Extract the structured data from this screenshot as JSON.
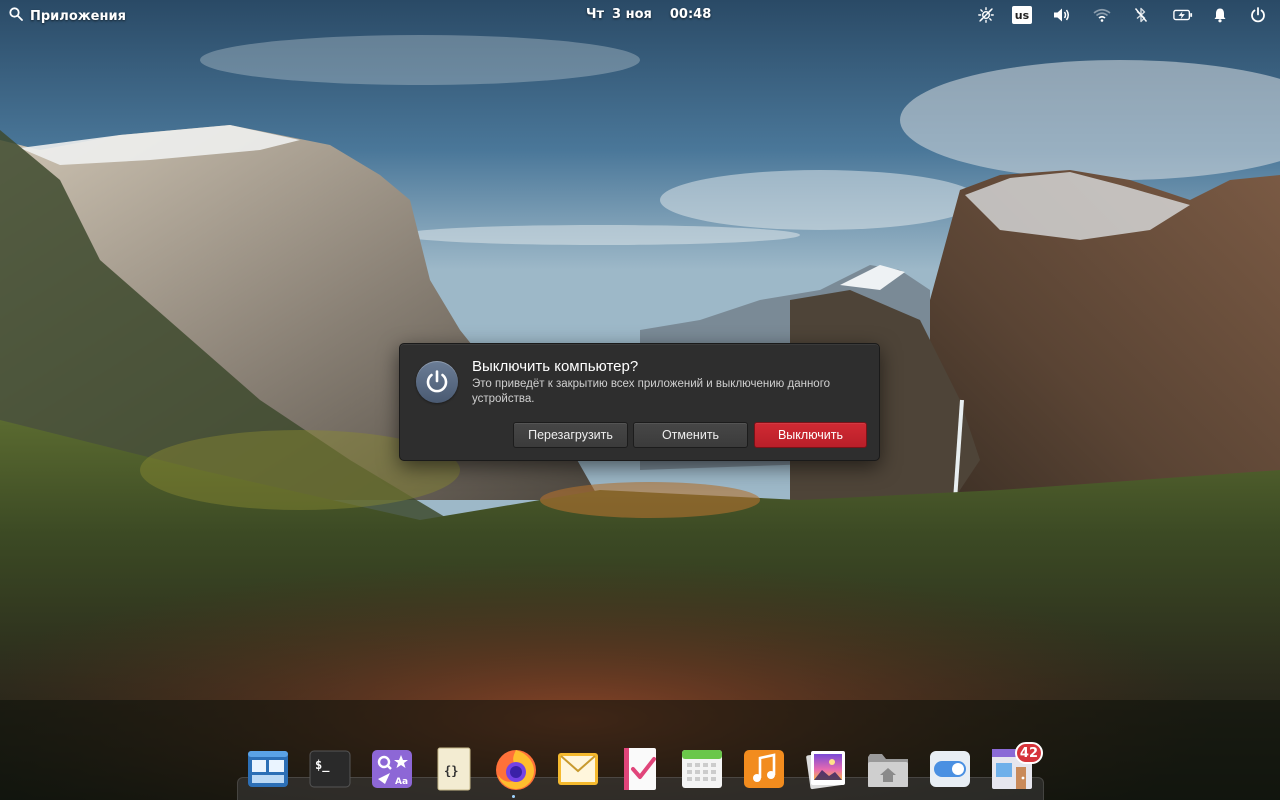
{
  "panel": {
    "applications_label": "Приложения",
    "date_day": "Чт",
    "date_date": "3 ноя",
    "time": "00:48",
    "keyboard_layout": "us"
  },
  "dialog": {
    "title": "Выключить компьютер?",
    "message": "Это приведёт к закрытию всех приложений и выключению данного устройства.",
    "restart_label": "Перезагрузить",
    "cancel_label": "Отменить",
    "shutdown_label": "Выключить",
    "danger_color": "#c7232c"
  },
  "dock": {
    "items": [
      {
        "name": "multitasking-view",
        "icon": "multitasking-icon"
      },
      {
        "name": "terminal",
        "icon": "terminal-icon"
      },
      {
        "name": "app-center",
        "icon": "appcenter-icon"
      },
      {
        "name": "code",
        "icon": "code-icon"
      },
      {
        "name": "firefox",
        "icon": "firefox-icon"
      },
      {
        "name": "mail",
        "icon": "mail-icon"
      },
      {
        "name": "tasks",
        "icon": "tasks-icon"
      },
      {
        "name": "calendar",
        "icon": "calendar-icon"
      },
      {
        "name": "music",
        "icon": "music-icon"
      },
      {
        "name": "photos",
        "icon": "photos-icon"
      },
      {
        "name": "files",
        "icon": "files-icon"
      },
      {
        "name": "system-settings",
        "icon": "settings-toggle-icon"
      },
      {
        "name": "appcenter-updates",
        "icon": "store-icon",
        "badge": "42"
      }
    ]
  }
}
